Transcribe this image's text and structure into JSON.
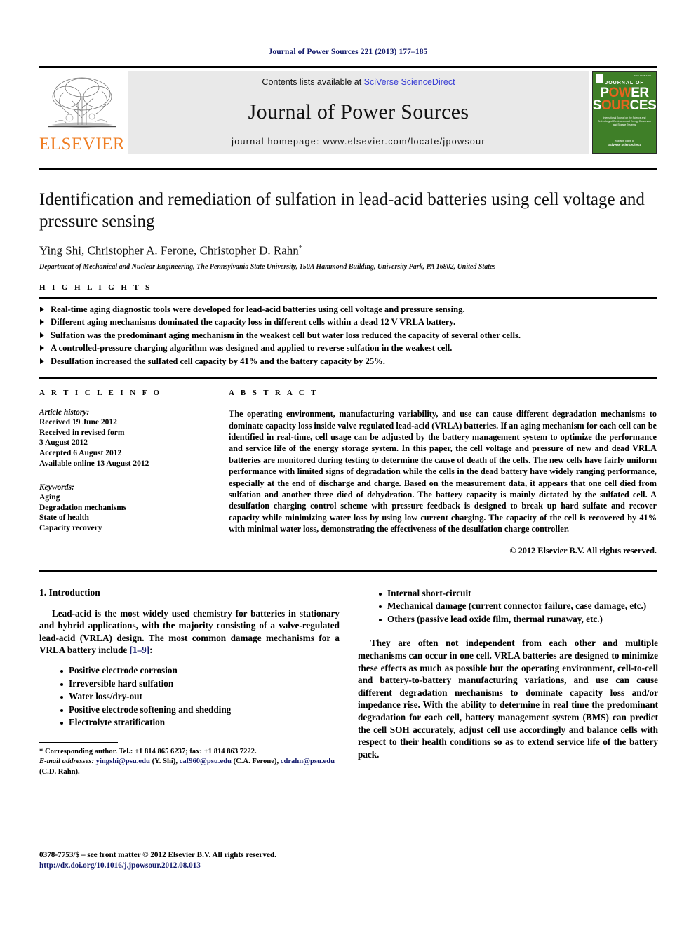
{
  "running_head": "Journal of Power Sources 221 (2013) 177–185",
  "masthead": {
    "publisher_logo_word": "ELSEVIER",
    "contents_prefix": "Contents lists available at ",
    "sciencedirect_link": "SciVerse ScienceDirect",
    "journal_name": "Journal of Power Sources",
    "homepage_line": "journal homepage: www.elsevier.com/locate/jpowsour",
    "cover": {
      "issn": "ISSN 0378-7753",
      "line1": "JOURNAL OF",
      "line2": "POWER",
      "line3": "SOURCES",
      "subtitle": "International Journal on the Science and Technology of Electrochemical Energy Conversion and Storage Systems",
      "footer_label": "Available online at",
      "footer_brand": "SciVerse ScienceDirect"
    }
  },
  "article": {
    "title": "Identification and remediation of sulfation in lead-acid batteries using cell voltage and pressure sensing",
    "authors": "Ying Shi, Christopher A. Ferone, Christopher D. Rahn",
    "corresponding_marker": "*",
    "affiliation": "Department of Mechanical and Nuclear Engineering, The Pennsylvania State University, 150A Hammond Building, University Park, PA 16802, United States"
  },
  "highlights": {
    "label": "H I G H L I G H T S",
    "items": [
      "Real-time aging diagnostic tools were developed for lead-acid batteries using cell voltage and pressure sensing.",
      "Different aging mechanisms dominated the capacity loss in different cells within a dead 12 V VRLA battery.",
      "Sulfation was the predominant aging mechanism in the weakest cell but water loss reduced the capacity of several other cells.",
      "A controlled-pressure charging algorithm was designed and applied to reverse sulfation in the weakest cell.",
      "Desulfation increased the sulfated cell capacity by 41% and the battery capacity by 25%."
    ]
  },
  "article_info": {
    "label": "A R T I C L E   I N F O",
    "history_label": "Article history:",
    "history": [
      "Received 19 June 2012",
      "Received in revised form",
      "3 August 2012",
      "Accepted 6 August 2012",
      "Available online 13 August 2012"
    ],
    "keywords_label": "Keywords:",
    "keywords": [
      "Aging",
      "Degradation mechanisms",
      "State of health",
      "Capacity recovery"
    ]
  },
  "abstract": {
    "label": "A B S T R A C T",
    "text": "The operating environment, manufacturing variability, and use can cause different degradation mechanisms to dominate capacity loss inside valve regulated lead-acid (VRLA) batteries. If an aging mechanism for each cell can be identified in real-time, cell usage can be adjusted by the battery management system to optimize the performance and service life of the energy storage system. In this paper, the cell voltage and pressure of new and dead VRLA batteries are monitored during testing to determine the cause of death of the cells. The new cells have fairly uniform performance with limited signs of degradation while the cells in the dead battery have widely ranging performance, especially at the end of discharge and charge. Based on the measurement data, it appears that one cell died from sulfation and another three died of dehydration. The battery capacity is mainly dictated by the sulfated cell. A desulfation charging control scheme with pressure feedback is designed to break up hard sulfate and recover capacity while minimizing water loss by using low current charging. The capacity of the cell is recovered by 41% with minimal water loss, demonstrating the effectiveness of the desulfation charge controller.",
    "copyright": "© 2012 Elsevier B.V. All rights reserved."
  },
  "body": {
    "section_heading": "1.  Introduction",
    "para1_a": "Lead-acid is the most widely used chemistry for batteries in stationary and hybrid applications, with the majority consisting of a valve-regulated lead-acid (VRLA) design. The most common damage mechanisms for a VRLA battery include ",
    "para1_ref": "[1–9]",
    "para1_b": ":",
    "left_bullets": [
      "Positive electrode corrosion",
      "Irreversible hard sulfation",
      "Water loss/dry-out",
      "Positive electrode softening and shedding",
      "Electrolyte stratification"
    ],
    "right_bullets": [
      "Internal short-circuit",
      "Mechanical damage (current connector failure, case damage, etc.)",
      "Others (passive lead oxide film, thermal runaway, etc.)"
    ],
    "para2": "They are often not independent from each other and multiple mechanisms can occur in one cell. VRLA batteries are designed to minimize these effects as much as possible but the operating environment, cell-to-cell and battery-to-battery manufacturing variations, and use can cause different degradation mechanisms to dominate capacity loss and/or impedance rise. With the ability to determine in real time the predominant degradation for each cell, battery management system (BMS) can predict the cell SOH accurately, adjust cell use accordingly and balance cells with respect to their health conditions so as to extend service life of the battery pack."
  },
  "footnote": {
    "corresponding": "* Corresponding author. Tel.: +1 814 865 6237; fax: +1 814 863 7222.",
    "email_label": "E-mail addresses:",
    "email1": "yingshi@psu.edu",
    "email1_who": " (Y. Shi), ",
    "email2": "caf960@psu.edu",
    "email2_who": " (C.A. Ferone), ",
    "email3": "cdrahn@psu.edu",
    "email3_who": " (C.D. Rahn)."
  },
  "page_footer": {
    "frontmatter": "0378-7753/$ – see front matter © 2012 Elsevier B.V. All rights reserved.",
    "doi": "http://dx.doi.org/10.1016/j.jpowsour.2012.08.013"
  },
  "colors": {
    "link_blue": "#131a6b",
    "sciencedirect_blue": "#3a3fd4",
    "elsevier_orange": "#ef7d22",
    "cover_green": "#3f7f28",
    "band_grey": "#e9e9e9"
  }
}
